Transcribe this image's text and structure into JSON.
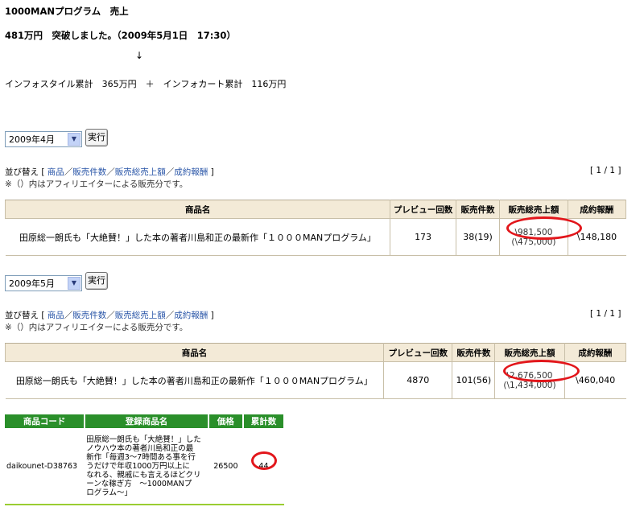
{
  "header": {
    "title": "1000MANプログラム　売上",
    "milestone": "481万円　突破しました。（2009年5月1日　17:30）",
    "arrow": "↓",
    "summary": "インフォスタイル累計　365万円　＋　インフォカート累計　116万円"
  },
  "april": {
    "select_value": "2009年4月",
    "run_label": "実行",
    "sort_prefix": "並び替え [ ",
    "sort_links": [
      "商品",
      "販売件数",
      "販売総売上額",
      "成約報酬"
    ],
    "sort_suffix": " ]",
    "note": "※（）内はアフィリエイターによる販売分です。",
    "pager": "[ 1 / 1 ]",
    "columns": [
      "商品名",
      "プレビュー回数",
      "販売件数",
      "販売総売上額",
      "成約報酬"
    ],
    "row": {
      "name": "田原総一朗氏も「大絶賛！」した本の著者川島和正の最新作「１０００MANプログラム」",
      "preview": "173",
      "sales": "38(19)",
      "total": "\\981,500",
      "total_sub": "(\\475,000)",
      "reward": "\\148,180"
    }
  },
  "may": {
    "select_value": "2009年5月",
    "run_label": "実行",
    "sort_prefix": "並び替え [ ",
    "sort_links": [
      "商品",
      "販売件数",
      "販売総売上額",
      "成約報酬"
    ],
    "sort_suffix": " ]",
    "note": "※（）内はアフィリエイターによる販売分です。",
    "pager": "[ 1 / 1 ]",
    "columns": [
      "商品名",
      "プレビュー回数",
      "販売件数",
      "販売総売上額",
      "成約報酬"
    ],
    "row": {
      "name": "田原総一朗氏も「大絶賛！」した本の著者川島和正の最新作「１０００MANプログラム」",
      "preview": "4870",
      "sales": "101(56)",
      "total": "\\2,676,500",
      "total_sub": "(\\1,434,000)",
      "reward": "\\460,040"
    }
  },
  "product": {
    "columns": [
      "商品コード",
      "登録商品名",
      "価格",
      "累計数"
    ],
    "code": "daikounet-D38763",
    "name_lines": [
      "田原総一朗氏も「大絶賛！」した",
      "ノウハウ本の著者川島和正の最",
      "新作「毎週3～7時間ある事を行",
      "うだけで年収1000万円以上に",
      "なれる、親戚にも言えるほどクリ",
      "ーンな稼ぎ方　～1000MANプ",
      "ログラム～」"
    ],
    "price": "26500",
    "count": "44"
  },
  "colors": {
    "highlight": "#e2161b",
    "table_header": "#f3ead7",
    "product_header": "#2a8f2a",
    "link": "#2a56a8"
  }
}
